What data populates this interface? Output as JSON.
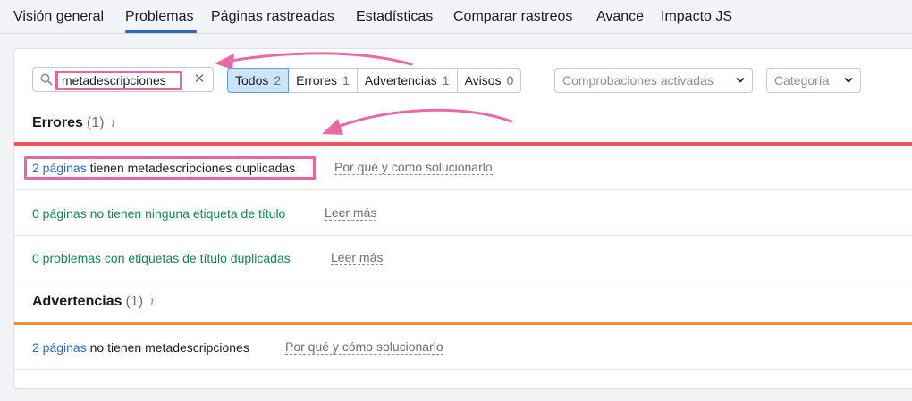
{
  "nav": {
    "tabs": [
      {
        "label": "Visión general"
      },
      {
        "label": "Problemas"
      },
      {
        "label": "Páginas rastreadas"
      },
      {
        "label": "Estadísticas"
      },
      {
        "label": "Comparar rastreos"
      },
      {
        "label": "Avance"
      },
      {
        "label": "Impacto JS"
      }
    ],
    "active_index": 1
  },
  "filters": {
    "search_value": "metadescripciones",
    "segments": [
      {
        "label": "Todos",
        "count": "2"
      },
      {
        "label": "Errores",
        "count": "1"
      },
      {
        "label": "Advertencias",
        "count": "1"
      },
      {
        "label": "Avisos",
        "count": "0"
      }
    ],
    "checks_dropdown": "Comprobaciones activadas",
    "category_dropdown": "Categoría"
  },
  "errors": {
    "title": "Errores",
    "count": "(1)",
    "info": "i",
    "rows": [
      {
        "link": "2 páginas",
        "text": " tienen metadescripciones duplicadas",
        "action": "Por qué y cómo solucionarlo"
      },
      {
        "text": "0 páginas no tienen ninguna etiqueta de título",
        "action": "Leer más"
      },
      {
        "text": "0 problemas con etiquetas de título duplicadas",
        "action": "Leer más"
      }
    ]
  },
  "warnings": {
    "title": "Advertencias",
    "count": "(1)",
    "info": "i",
    "rows": [
      {
        "link": "2 páginas",
        "text": " no tienen metadescripciones",
        "action": "Por qué y cómo solucionarlo"
      }
    ]
  },
  "colors": {
    "accent": "#2a6ab8",
    "error_bar": "#f0505f",
    "warning_bar": "#f58a3c",
    "highlight": "#e26aa4",
    "green_text": "#118654"
  }
}
